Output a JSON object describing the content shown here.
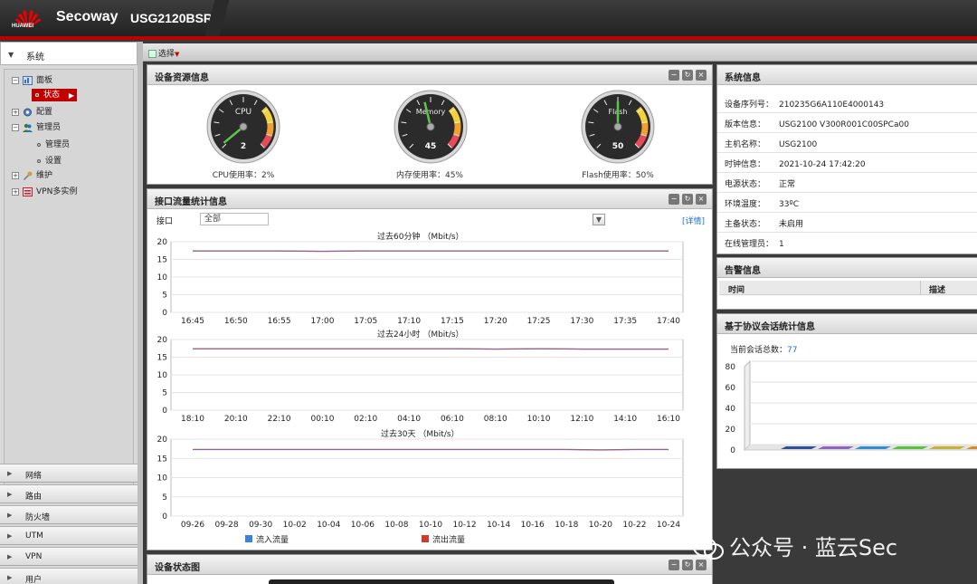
{
  "header": {
    "brand_logo_text": "HUAWEI",
    "brand": "Secoway",
    "model": "USG2120BSR"
  },
  "sidebar": {
    "top_section": "系统",
    "tree": {
      "panel": "面板",
      "status": "状态",
      "config": "配置",
      "admin": "管理员",
      "admin_sub": "管理员",
      "settings": "设置",
      "maintenance": "维护",
      "vpn_instance": "VPN多实例"
    },
    "menus": [
      "网络",
      "路由",
      "防火墙",
      "UTM",
      "VPN",
      "用户"
    ]
  },
  "toolbar": {
    "select_label": "选择"
  },
  "resource_panel": {
    "title": "设备资源信息",
    "gauges": [
      {
        "name": "CPU",
        "value": 2,
        "label": "CPU使用率：2%"
      },
      {
        "name": "Memory",
        "value": 45,
        "label": "内存使用率：45%"
      },
      {
        "name": "Flash",
        "value": 50,
        "label": "Flash使用率：50%"
      }
    ]
  },
  "traffic_panel": {
    "title": "接口流量统计信息",
    "iface_label": "接口",
    "iface_value": "全部",
    "detail_link": "[详情]",
    "legend_in": "流入流量",
    "legend_out": "流出流量",
    "colors": {
      "in": "#3b82e0",
      "out": "#d33a2a"
    }
  },
  "chart_data": [
    {
      "type": "line",
      "title": "过去60分钟  （Mbit/s）",
      "ylim": [
        0,
        20
      ],
      "yticks": [
        20,
        15,
        10,
        5,
        0
      ],
      "categories": [
        "16:45",
        "16:50",
        "16:55",
        "17:00",
        "17:05",
        "17:10",
        "17:15",
        "17:20",
        "17:25",
        "17:30",
        "17:35",
        "17:40"
      ],
      "series": [
        {
          "name": "流出流量",
          "values": [
            17.4,
            17.4,
            17.4,
            17.3,
            17.4,
            17.4,
            17.4,
            17.4,
            17.4,
            17.4,
            17.4,
            17.4
          ]
        },
        {
          "name": "流入流量",
          "values": [
            17.4,
            17.4,
            17.4,
            17.3,
            17.4,
            17.4,
            17.4,
            17.4,
            17.4,
            17.4,
            17.4,
            17.4
          ]
        }
      ]
    },
    {
      "type": "line",
      "title": "过去24小时  （Mbit/s）",
      "ylim": [
        0,
        20
      ],
      "yticks": [
        20,
        15,
        10,
        5,
        0
      ],
      "categories": [
        "18:10",
        "20:10",
        "22:10",
        "00:10",
        "02:10",
        "04:10",
        "06:10",
        "08:10",
        "10:10",
        "12:10",
        "14:10",
        "16:10"
      ],
      "series": [
        {
          "name": "流出流量",
          "values": [
            17.4,
            17.4,
            17.4,
            17.4,
            17.4,
            17.4,
            17.4,
            17.3,
            17.4,
            17.3,
            17.3,
            17.3
          ]
        },
        {
          "name": "流入流量",
          "values": [
            17.4,
            17.4,
            17.4,
            17.4,
            17.4,
            17.4,
            17.4,
            17.3,
            17.4,
            17.3,
            17.3,
            17.3
          ]
        }
      ]
    },
    {
      "type": "line",
      "title": "过去30天  （Mbit/s）",
      "ylim": [
        0,
        20
      ],
      "yticks": [
        20,
        15,
        10,
        5,
        0
      ],
      "categories": [
        "09-26",
        "09-28",
        "09-30",
        "10-02",
        "10-04",
        "10-06",
        "10-08",
        "10-10",
        "10-12",
        "10-14",
        "10-16",
        "10-18",
        "10-20",
        "10-22",
        "10-24"
      ],
      "series": [
        {
          "name": "流出流量",
          "values": [
            17.3,
            17.3,
            17.3,
            17.3,
            17.3,
            17.3,
            17.3,
            17.3,
            17.3,
            17.3,
            17.3,
            17.3,
            17.2,
            17.3,
            17.3
          ]
        },
        {
          "name": "流入流量",
          "values": [
            17.3,
            17.3,
            17.3,
            17.3,
            17.3,
            17.3,
            17.3,
            17.3,
            17.3,
            17.3,
            17.3,
            17.3,
            17.2,
            17.3,
            17.3
          ]
        }
      ]
    },
    {
      "type": "bar",
      "ylim": [
        0,
        80
      ],
      "yticks": [
        80,
        60,
        40,
        20,
        0
      ],
      "values": [
        1,
        1,
        1,
        2,
        1,
        1
      ],
      "colors": [
        "#2e4f9a",
        "#8f63c0",
        "#2f8fd0",
        "#5cbf3c",
        "#c8b032",
        "#d68a2a"
      ]
    }
  ],
  "status_panel": {
    "title": "设备状态图"
  },
  "system_info": {
    "title": "系统信息",
    "rows": [
      {
        "k": "设备序列号：",
        "v": "210235G6A110E4000143"
      },
      {
        "k": "版本信息：",
        "v": "USG2100 V300R001C00SPCa00"
      },
      {
        "k": "主机名称：",
        "v": "USG2100"
      },
      {
        "k": "时钟信息：",
        "v": "2021-10-24 17:42:20"
      },
      {
        "k": "电源状态：",
        "v": "正常"
      },
      {
        "k": "环境温度：",
        "v": "33ºC"
      },
      {
        "k": "主备状态：",
        "v": "未启用"
      },
      {
        "k": "在线管理员：",
        "v": "1"
      }
    ]
  },
  "alarm_panel": {
    "title": "告警信息",
    "col_time": "时间",
    "col_desc": "描述"
  },
  "session_panel": {
    "title": "基于协议会话统计信息",
    "count_label": "当前会话总数：",
    "count_value": "77"
  },
  "watermark": "公众号 · 蓝云Sec"
}
